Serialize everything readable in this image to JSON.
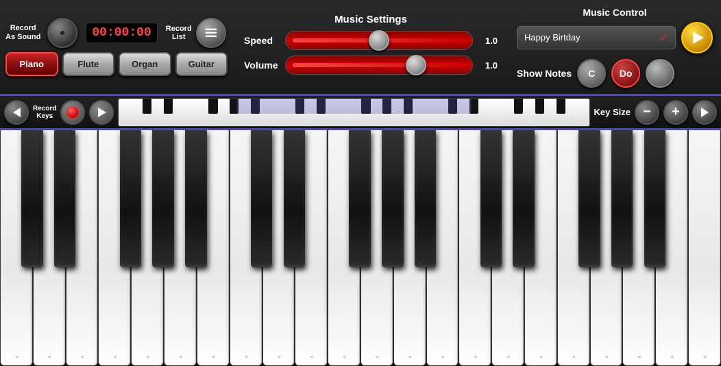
{
  "header": {
    "record_as_sound": "Record\nAs Sound",
    "record_as_sound_line1": "Record",
    "record_as_sound_line2": "As Sound",
    "timer": "00:00:00",
    "record_list_line1": "Record",
    "record_list_line2": "List"
  },
  "instruments": {
    "active": "Piano",
    "buttons": [
      "Piano",
      "Flute",
      "Organ",
      "Guitar"
    ]
  },
  "music_settings": {
    "title": "Music Settings",
    "speed_label": "Speed",
    "speed_value": "1.0",
    "volume_label": "Volume",
    "volume_value": "1.0"
  },
  "music_control": {
    "title": "Music Control",
    "selected_song": "Happy Birtday",
    "show_notes_label": "Show Notes",
    "note_c": "C",
    "note_do": "Do"
  },
  "record_keys_bar": {
    "record_keys_label": "Record\nKeys",
    "key_size_label": "Key Size",
    "minus": "−",
    "plus": "+"
  }
}
